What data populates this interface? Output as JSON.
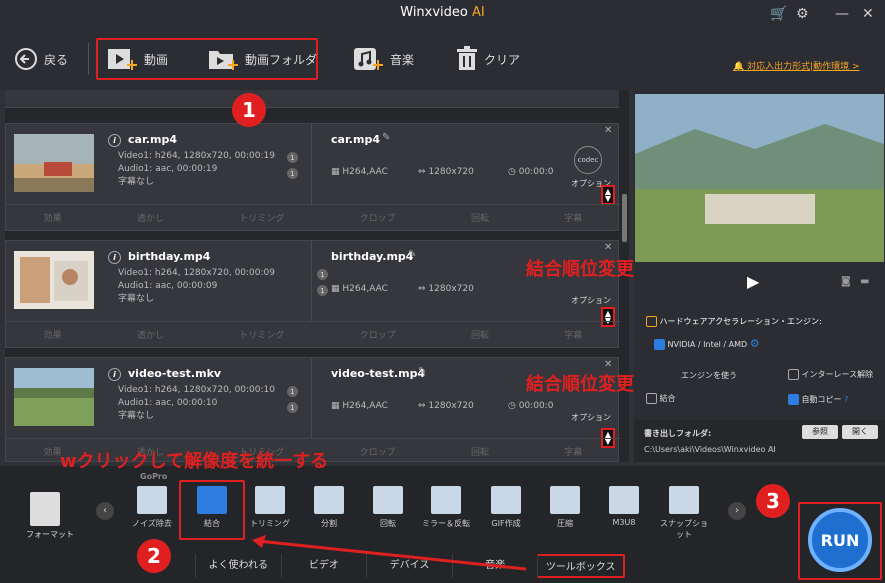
{
  "app": {
    "title": "Winxvideo",
    "title_ai": "AI"
  },
  "toolbar": {
    "back": "戻る",
    "video": "動画",
    "video_folder": "動画フォルダ",
    "music": "音楽",
    "clear": "クリア",
    "formats_link": "対応入出力形式|動作環境 >"
  },
  "items": [
    {
      "name": "car.mp4",
      "video": "Video1: h264, 1280x720, 00:00:19",
      "audio": "Audio1: aac, 00:00:19",
      "sub": "字幕なし",
      "out_name": "car.mp4",
      "codec": "H264,AAC",
      "res": "1280x720",
      "dur": "00:00:0",
      "n1": "1",
      "n2": "1"
    },
    {
      "name": "birthday.mp4",
      "video": "Video1: h264, 1280x720, 00:00:09",
      "audio": "Audio1: aac, 00:00:09",
      "sub": "字幕なし",
      "out_name": "birthday.mp4",
      "codec": "H264,AAC",
      "res": "1280x720",
      "dur": "00:00:0",
      "n1": "1",
      "n2": "1"
    },
    {
      "name": "video-test.mkv",
      "video": "Video1: h264, 1280x720, 00:00:10",
      "audio": "Audio1: aac, 00:00:10",
      "sub": "字幕なし",
      "out_name": "video-test.mp4",
      "codec": "H264,AAC",
      "res": "1280x720",
      "dur": "00:00:0",
      "n1": "1",
      "n2": "1"
    }
  ],
  "actions": [
    "効果",
    "透かし",
    "トリミング",
    "クロップ",
    "回転",
    "字幕"
  ],
  "option": "オプション",
  "codec_label": "codec",
  "annotations": {
    "reorder1": "結合順位変更",
    "reorder2": "結合順位変更",
    "dblclick": "wクリックして解像度を統一する",
    "n1": "1",
    "n2": "2",
    "n3": "3"
  },
  "right": {
    "hw_accel": "ハードウェアアクセラレーション・エンジン:",
    "nvidia": "NVIDIA / Intel / AMD",
    "engine": "エンジンを使う",
    "deinterlace": "インターレース解除",
    "merge": "結合",
    "autocopy": "自動コピー",
    "help": "?",
    "output_label": "書き出しフォルダ:",
    "browse": "参照",
    "open": "開く",
    "path": "C:\\Users\\aki\\Videos\\Winxvideo AI"
  },
  "bottom": {
    "format": "フォーマット",
    "tools": [
      "ノイズ除去",
      "結合",
      "トリミング",
      "分割",
      "回転",
      "ミラー＆反転",
      "GIF作成",
      "圧縮",
      "M3U8",
      "スナップショット"
    ],
    "gopro": "GoPro",
    "tabs": [
      "よく使われる",
      "ビデオ",
      "デバイス",
      "音楽",
      "ツールボックス"
    ],
    "run": "RUN"
  }
}
